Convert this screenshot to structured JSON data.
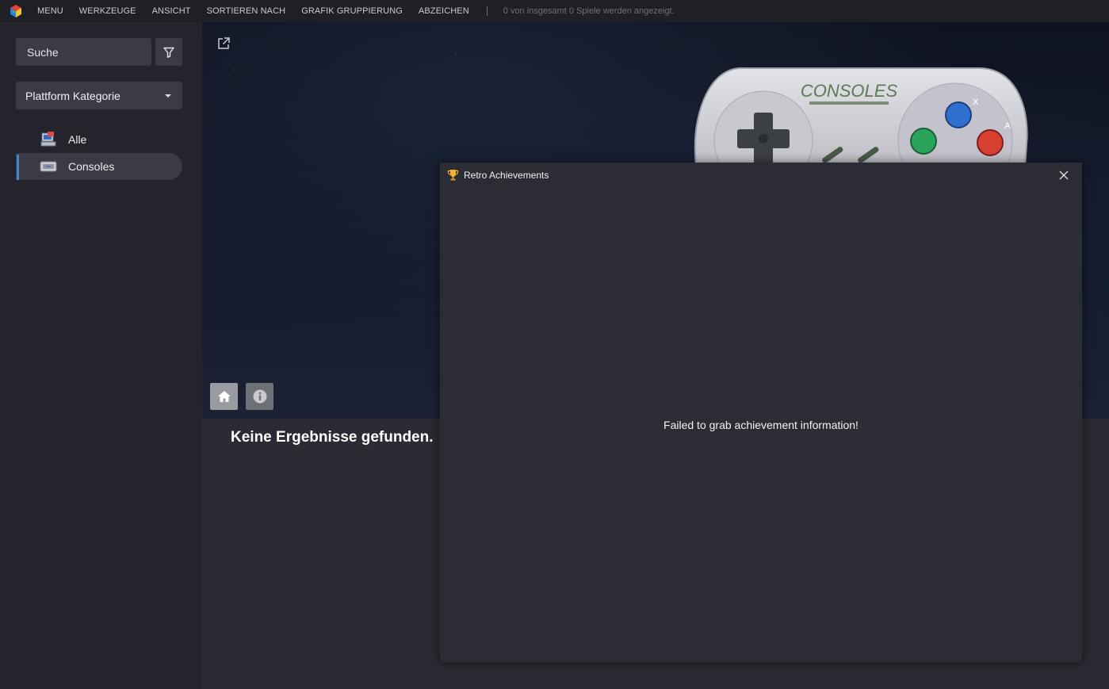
{
  "menubar": {
    "items": [
      "MENU",
      "WERKZEUGE",
      "ANSICHT",
      "SORTIEREN NACH",
      "GRAFIK GRUPPIERUNG",
      "ABZEICHEN"
    ],
    "status": "0 von insgesamt 0 Spiele werden angezeigt."
  },
  "sidebar": {
    "search_placeholder": "Suche",
    "platform_select": "Plattform Kategorie",
    "items": [
      {
        "label": "Alle",
        "icon": "all-platforms-icon",
        "active": false
      },
      {
        "label": "Consoles",
        "icon": "console-icon",
        "active": true
      }
    ]
  },
  "hero": {
    "brand_text": "CONSOLES",
    "controller_buttons": [
      "X",
      "A"
    ]
  },
  "main": {
    "empty_message": "Keine Ergebnisse gefunden."
  },
  "dialog": {
    "title": "Retro Achievements",
    "message": "Failed to grab achievement information!"
  },
  "colors": {
    "accent": "#4d7fd0",
    "sidebar_bg": "#24252c",
    "menubar_bg": "#1f2026",
    "dialog_bg": "#2b2c34"
  }
}
